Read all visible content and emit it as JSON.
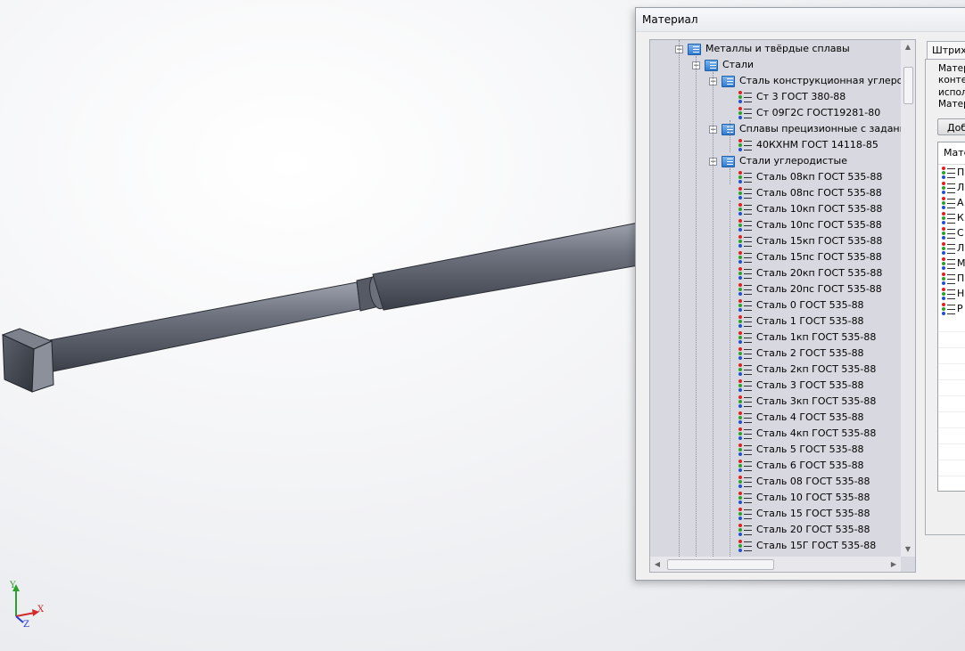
{
  "dialog": {
    "title": "Материал"
  },
  "tree": {
    "items": [
      {
        "label": "Металлы и твёрдые сплавы",
        "kind": "folder"
      },
      {
        "label": "Стали",
        "kind": "folder"
      },
      {
        "label": "Сталь конструкционная углероди",
        "kind": "folder"
      },
      {
        "label": "Ст 3 ГОСТ 380-88",
        "kind": "material"
      },
      {
        "label": "Ст 09Г2С ГОСТ19281-80",
        "kind": "material"
      },
      {
        "label": "Сплавы прецизионные с заданны",
        "kind": "folder"
      },
      {
        "label": "40КХНМ ГОСТ 14118-85",
        "kind": "material"
      },
      {
        "label": "Стали углеродистые",
        "kind": "folder"
      },
      {
        "label": "Сталь 08кп ГОСТ 535-88",
        "kind": "material"
      },
      {
        "label": "Сталь 08пс ГОСТ 535-88",
        "kind": "material"
      },
      {
        "label": "Сталь 10кп ГОСТ 535-88",
        "kind": "material"
      },
      {
        "label": "Сталь 10пс ГОСТ 535-88",
        "kind": "material"
      },
      {
        "label": "Сталь 15кп ГОСТ 535-88",
        "kind": "material"
      },
      {
        "label": "Сталь 15пс ГОСТ 535-88",
        "kind": "material"
      },
      {
        "label": "Сталь 20кп ГОСТ 535-88",
        "kind": "material"
      },
      {
        "label": "Сталь 20пс ГОСТ 535-88",
        "kind": "material"
      },
      {
        "label": "Сталь 0 ГОСТ 535-88",
        "kind": "material"
      },
      {
        "label": "Сталь 1 ГОСТ 535-88",
        "kind": "material"
      },
      {
        "label": "Сталь 1кп ГОСТ 535-88",
        "kind": "material"
      },
      {
        "label": "Сталь 2 ГОСТ 535-88",
        "kind": "material"
      },
      {
        "label": "Сталь 2кп ГОСТ 535-88",
        "kind": "material"
      },
      {
        "label": "Сталь 3 ГОСТ 535-88",
        "kind": "material"
      },
      {
        "label": "Сталь 3кп ГОСТ 535-88",
        "kind": "material"
      },
      {
        "label": "Сталь 4 ГОСТ 535-88",
        "kind": "material"
      },
      {
        "label": "Сталь 4кп ГОСТ 535-88",
        "kind": "material"
      },
      {
        "label": "Сталь 5 ГОСТ 535-88",
        "kind": "material"
      },
      {
        "label": "Сталь 6 ГОСТ 535-88",
        "kind": "material"
      },
      {
        "label": "Сталь 08 ГОСТ 535-88",
        "kind": "material"
      },
      {
        "label": "Сталь 10 ГОСТ 535-88",
        "kind": "material"
      },
      {
        "label": "Сталь 15 ГОСТ 535-88",
        "kind": "material"
      },
      {
        "label": "Сталь 20 ГОСТ 535-88",
        "kind": "material"
      },
      {
        "label": "Сталь 15Г ГОСТ 535-88",
        "kind": "material"
      }
    ]
  },
  "right_panel": {
    "tab_label": "Штрихо",
    "description_lines": [
      "Матер",
      "конте",
      "испол",
      "Матер"
    ],
    "add_button": "Доб",
    "list_header": "Мате",
    "list_items": [
      "П",
      "Л",
      "А",
      "К",
      "С",
      "Л",
      "М",
      "П",
      "Н",
      "Р"
    ]
  },
  "triad": {
    "x": "X",
    "y": "Y",
    "z": "Z"
  },
  "colors": {
    "tree_bg": "#d8d9e0",
    "folder_icon": "#2f7bd4",
    "model_steel": "#5a5f6a"
  }
}
